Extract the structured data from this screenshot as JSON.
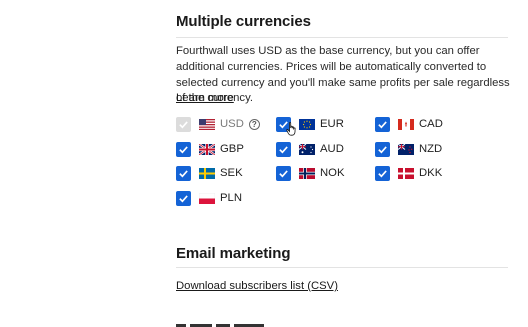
{
  "currencies_section": {
    "title": "Multiple currencies",
    "description": "Fourthwall uses USD as the base currency, but you can offer additional currencies. Prices will be automatically converted to selected currency and you'll make same profits per sale regardless of the currency.",
    "learn_more": "Learn more",
    "items": [
      {
        "code": "USD",
        "flag": "us-flag-icon",
        "checked": true,
        "disabled": true
      },
      {
        "code": "EUR",
        "flag": "eu-flag-icon",
        "checked": true,
        "disabled": false
      },
      {
        "code": "CAD",
        "flag": "ca-flag-icon",
        "checked": true,
        "disabled": false
      },
      {
        "code": "GBP",
        "flag": "gb-flag-icon",
        "checked": true,
        "disabled": false
      },
      {
        "code": "AUD",
        "flag": "au-flag-icon",
        "checked": true,
        "disabled": false
      },
      {
        "code": "NZD",
        "flag": "nz-flag-icon",
        "checked": true,
        "disabled": false
      },
      {
        "code": "SEK",
        "flag": "se-flag-icon",
        "checked": true,
        "disabled": false
      },
      {
        "code": "NOK",
        "flag": "no-flag-icon",
        "checked": true,
        "disabled": false
      },
      {
        "code": "DKK",
        "flag": "dk-flag-icon",
        "checked": true,
        "disabled": false
      },
      {
        "code": "PLN",
        "flag": "pl-flag-icon",
        "checked": true,
        "disabled": false
      }
    ],
    "usd_help": "?"
  },
  "email_section": {
    "title": "Email marketing",
    "download_link": "Download subscribers list (CSV)"
  },
  "colors": {
    "accent": "#1463d6",
    "disabled": "#dcdcdc"
  }
}
